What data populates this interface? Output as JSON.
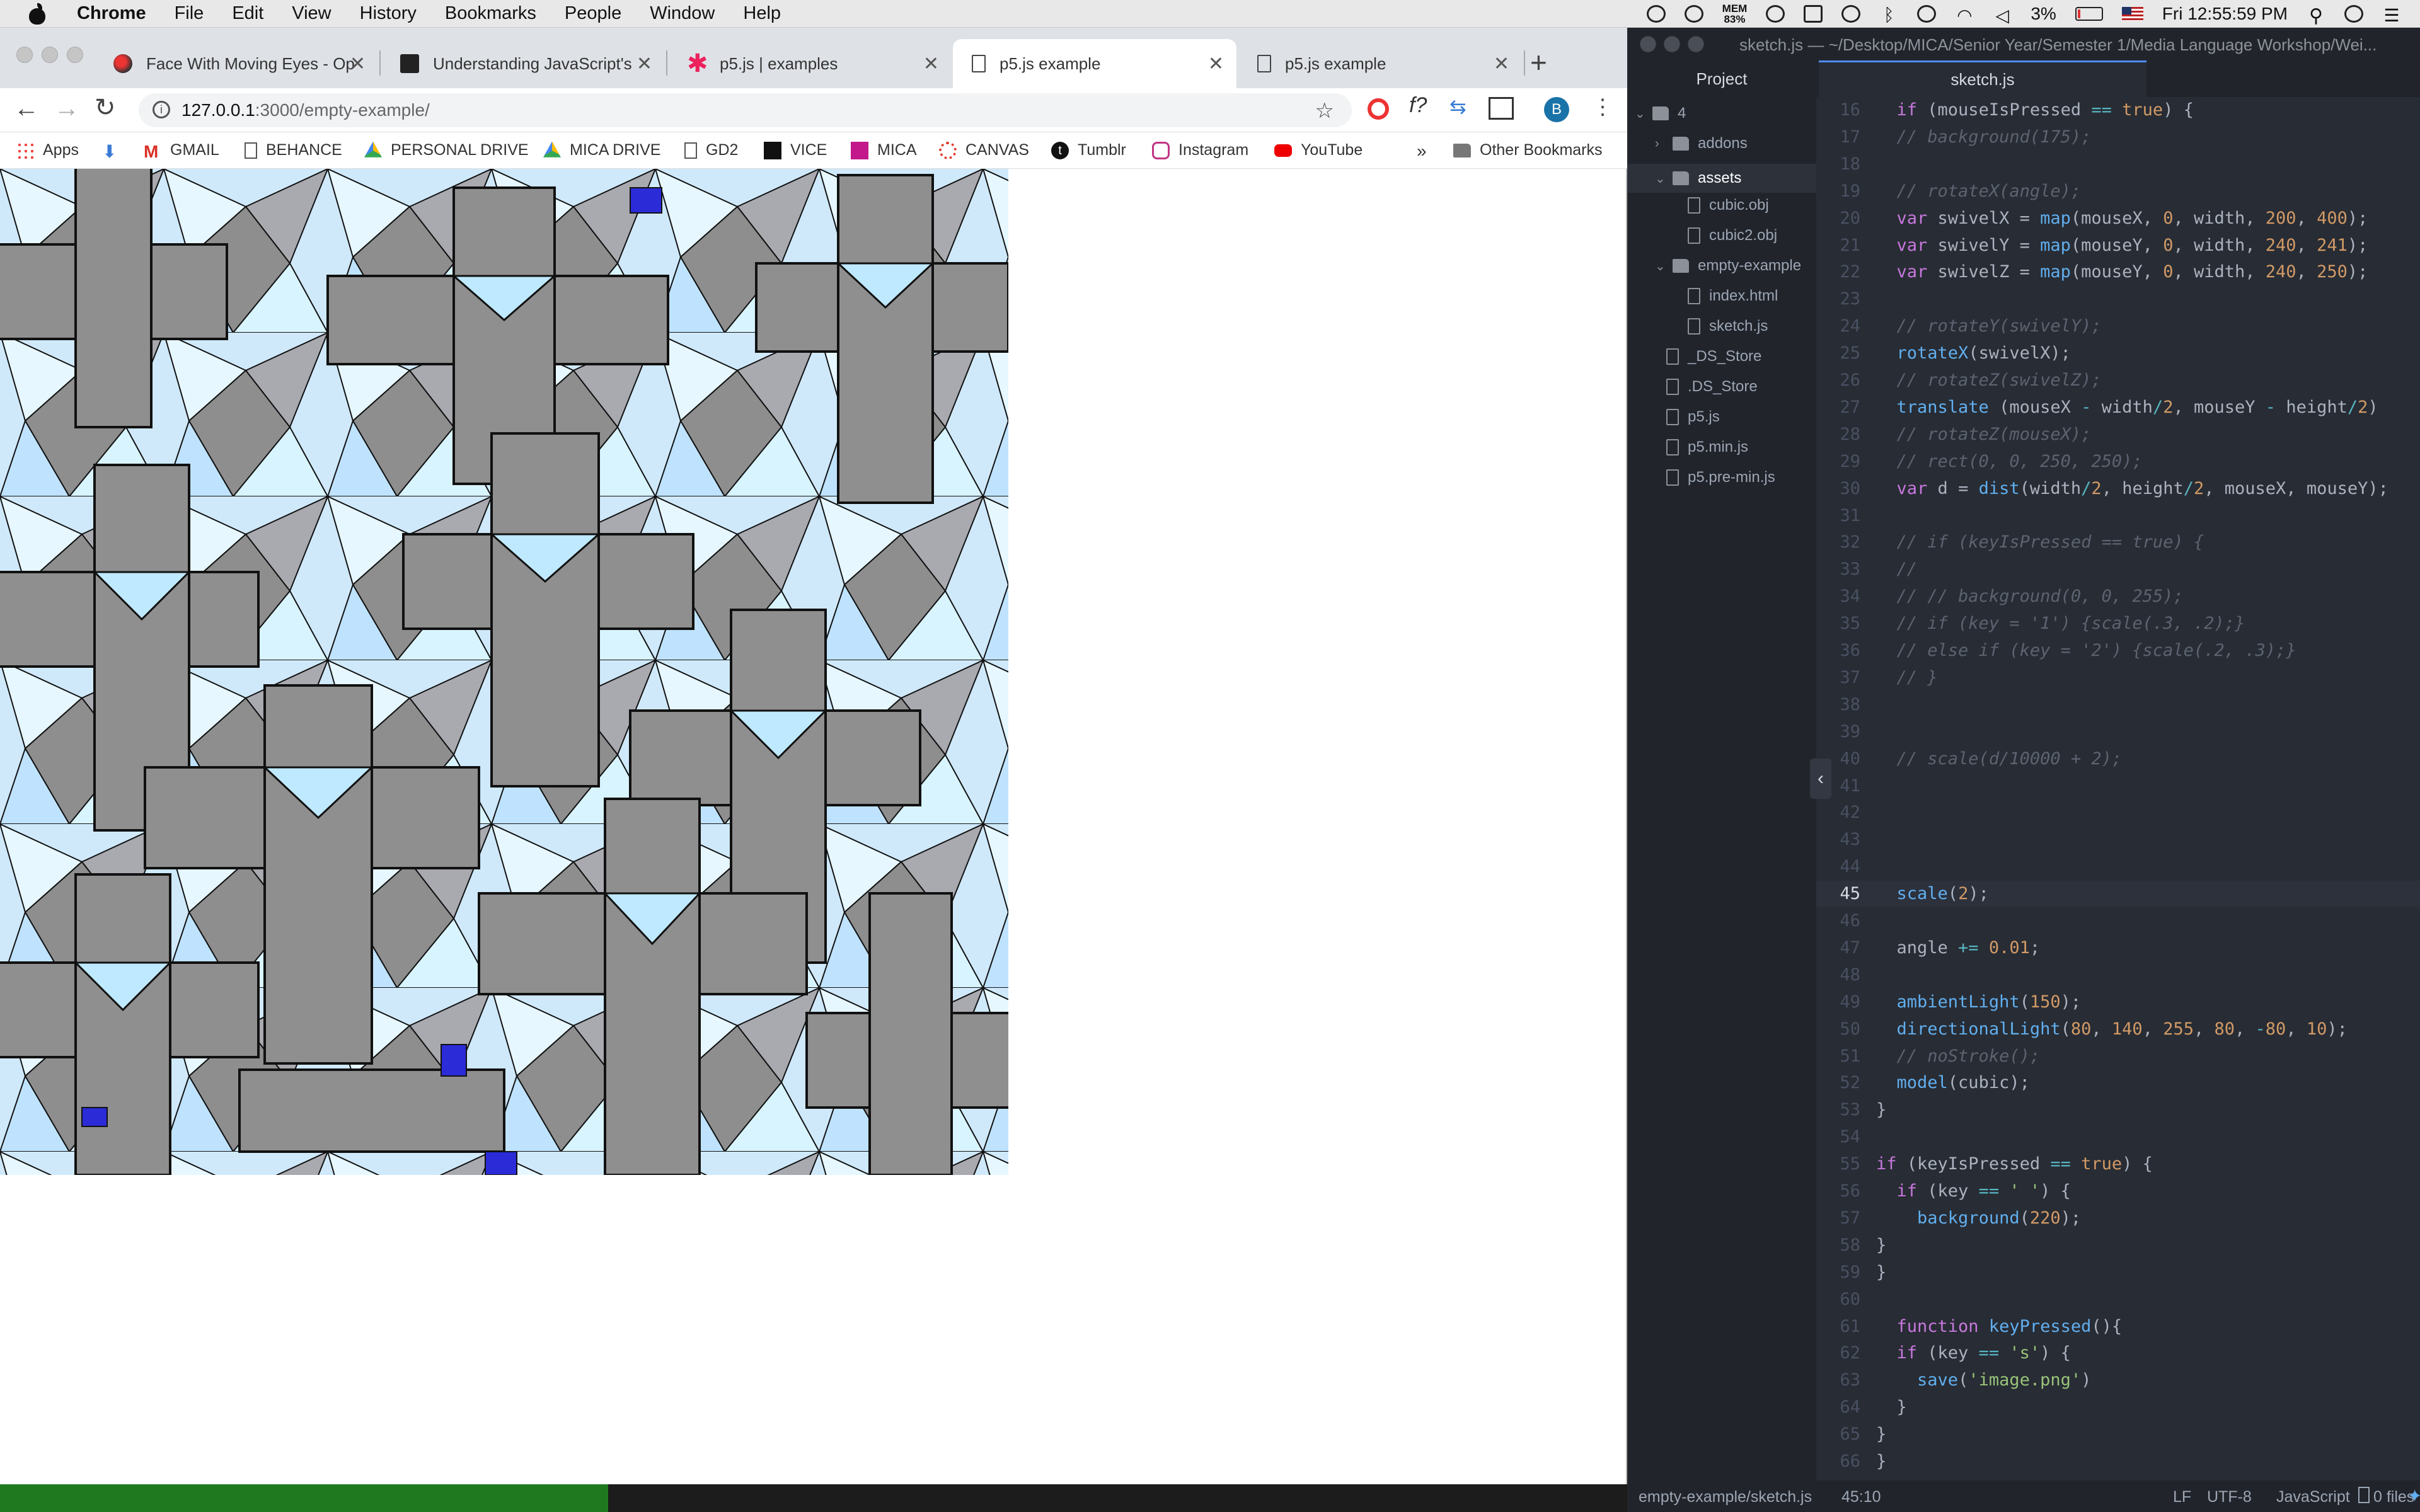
{
  "menubar": {
    "app": "Chrome",
    "items": [
      "File",
      "Edit",
      "View",
      "History",
      "Bookmarks",
      "People",
      "Window",
      "Help"
    ],
    "mem_label": "MEM",
    "mem_value": "83%",
    "battery": "3%",
    "clock": "Fri 12:55:59 PM"
  },
  "browser": {
    "tabs": [
      {
        "title": "Face With Moving Eyes - Op",
        "active": false
      },
      {
        "title": "Understanding JavaScript's",
        "active": false
      },
      {
        "title": "p5.js | examples",
        "active": false
      },
      {
        "title": "p5.js example",
        "active": true
      },
      {
        "title": "p5.js example",
        "active": false
      }
    ],
    "new_tab": "+",
    "url_host": "127.0.0.1",
    "url_path": ":3000/empty-example/",
    "profile_initial": "B",
    "bookmarks": [
      "Apps",
      "GMAIL",
      "BEHANCE",
      "PERSONAL DRIVE",
      "MICA DRIVE",
      "GD2",
      "VICE",
      "MICA",
      "CANVAS",
      "Tumblr",
      "Instagram",
      "YouTube"
    ],
    "more_bookmarks": "»",
    "other_bookmarks": "Other Bookmarks"
  },
  "editor": {
    "title": "sketch.js — ~/Desktop/MICA/Senior Year/Semester 1/Media Language Workshop/Wei...",
    "project_label": "Project",
    "active_tab": "sketch.js",
    "tree": [
      {
        "name": "4",
        "depth": 0,
        "type": "folder",
        "expanded": true
      },
      {
        "name": "addons",
        "depth": 1,
        "type": "folder",
        "expanded": false
      },
      {
        "name": "assets",
        "depth": 1,
        "type": "folder",
        "expanded": true,
        "selected": true
      },
      {
        "name": "cubic.obj",
        "depth": 2,
        "type": "file"
      },
      {
        "name": "cubic2.obj",
        "depth": 2,
        "type": "file"
      },
      {
        "name": "empty-example",
        "depth": 1,
        "type": "folder",
        "expanded": true
      },
      {
        "name": "index.html",
        "depth": 2,
        "type": "file"
      },
      {
        "name": "sketch.js",
        "depth": 2,
        "type": "file"
      },
      {
        "name": "_DS_Store",
        "depth": 1,
        "type": "file"
      },
      {
        "name": ".DS_Store",
        "depth": 1,
        "type": "file"
      },
      {
        "name": "p5.js",
        "depth": 1,
        "type": "file"
      },
      {
        "name": "p5.min.js",
        "depth": 1,
        "type": "file"
      },
      {
        "name": "p5.pre-min.js",
        "depth": 1,
        "type": "file"
      }
    ],
    "current_line": 45,
    "lines": [
      {
        "n": 16,
        "code": "  if (mouseIsPressed == true) {"
      },
      {
        "n": 17,
        "code": "  // background(175);"
      },
      {
        "n": 18,
        "code": ""
      },
      {
        "n": 19,
        "code": "  // rotateX(angle);"
      },
      {
        "n": 20,
        "code": "  var swivelX = map(mouseX, 0, width, 200, 400);"
      },
      {
        "n": 21,
        "code": "  var swivelY = map(mouseY, 0, width, 240, 241);"
      },
      {
        "n": 22,
        "code": "  var swivelZ = map(mouseY, 0, width, 240, 250);"
      },
      {
        "n": 23,
        "code": ""
      },
      {
        "n": 24,
        "code": "  // rotateY(swivelY);"
      },
      {
        "n": 25,
        "code": "  rotateX(swivelX);"
      },
      {
        "n": 26,
        "code": "  // rotateZ(swivelZ);"
      },
      {
        "n": 27,
        "code": "  translate (mouseX - width/2, mouseY - height/2)"
      },
      {
        "n": 28,
        "code": "  // rotateZ(mouseX);"
      },
      {
        "n": 29,
        "code": "  // rect(0, 0, 250, 250);"
      },
      {
        "n": 30,
        "code": "  var d = dist(width/2, height/2, mouseX, mouseY);"
      },
      {
        "n": 31,
        "code": ""
      },
      {
        "n": 32,
        "code": "  // if (keyIsPressed == true) {"
      },
      {
        "n": 33,
        "code": "  //"
      },
      {
        "n": 34,
        "code": "  // // background(0, 0, 255);"
      },
      {
        "n": 35,
        "code": "  // if (key = '1') {scale(.3, .2);}"
      },
      {
        "n": 36,
        "code": "  // else if (key = '2') {scale(.2, .3);}"
      },
      {
        "n": 37,
        "code": "  // }"
      },
      {
        "n": 38,
        "code": ""
      },
      {
        "n": 39,
        "code": ""
      },
      {
        "n": 40,
        "code": "  // scale(d/10000 + 2);"
      },
      {
        "n": 41,
        "code": ""
      },
      {
        "n": 42,
        "code": ""
      },
      {
        "n": 43,
        "code": ""
      },
      {
        "n": 44,
        "code": ""
      },
      {
        "n": 45,
        "code": "  scale(2);"
      },
      {
        "n": 46,
        "code": ""
      },
      {
        "n": 47,
        "code": "  angle += 0.01;"
      },
      {
        "n": 48,
        "code": ""
      },
      {
        "n": 49,
        "code": "  ambientLight(150);"
      },
      {
        "n": 50,
        "code": "  directionalLight(80, 140, 255, 80, -80, 10);"
      },
      {
        "n": 51,
        "code": "  // noStroke();"
      },
      {
        "n": 52,
        "code": "  model(cubic);"
      },
      {
        "n": 53,
        "code": "}"
      },
      {
        "n": 54,
        "code": ""
      },
      {
        "n": 55,
        "code": "if (keyIsPressed == true) {"
      },
      {
        "n": 56,
        "code": "  if (key == ' ') {"
      },
      {
        "n": 57,
        "code": "    background(220);"
      },
      {
        "n": 58,
        "code": "}"
      },
      {
        "n": 59,
        "code": "}"
      },
      {
        "n": 60,
        "code": ""
      },
      {
        "n": 61,
        "code": "  function keyPressed(){"
      },
      {
        "n": 62,
        "code": "  if (key == 's') {"
      },
      {
        "n": 63,
        "code": "    save('image.png')"
      },
      {
        "n": 64,
        "code": "  }"
      },
      {
        "n": 65,
        "code": "}"
      },
      {
        "n": 66,
        "code": "}"
      },
      {
        "n": 67,
        "code": ""
      }
    ],
    "status": {
      "path": "empty-example/sketch.js",
      "cursor": "45:10",
      "line_ending": "LF",
      "encoding": "UTF-8",
      "grammar": "JavaScript",
      "files": "0 files"
    }
  },
  "colors": {
    "accent": "#528bff",
    "menubar": "#e8e8e8",
    "editor_bg": "#282c34"
  }
}
